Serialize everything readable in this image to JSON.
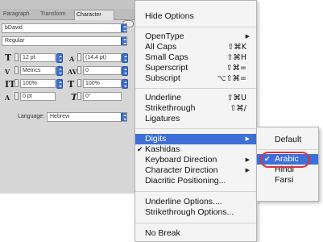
{
  "character_panel": {
    "tabs": [
      "Paragraph",
      "Transform",
      "Character"
    ],
    "font_family": "bDavid",
    "font_style": "Regular",
    "font_size": "12 pt",
    "leading": "(14.4 pt)",
    "kerning": "Metrics",
    "tracking": "0",
    "vertical_scale": "100%",
    "horizontal_scale": "100%",
    "baseline_shift": "0 pt",
    "skew": "0°",
    "language_label": "Language:",
    "language_value": "Hebrew"
  },
  "menu": {
    "hide_options": "Hide Options",
    "opentype": "OpenType",
    "all_caps": {
      "label": "All Caps",
      "shortcut": "⇧⌘K"
    },
    "small_caps": {
      "label": "Small Caps",
      "shortcut": "⇧⌘H"
    },
    "superscript": {
      "label": "Superscript",
      "shortcut": "⇧⌘="
    },
    "subscript": {
      "label": "Subscript",
      "shortcut": "⌥⇧⌘="
    },
    "underline": {
      "label": "Underline",
      "shortcut": "⇧⌘U"
    },
    "strikethrough": {
      "label": "Strikethrough",
      "shortcut": "⇧⌘/"
    },
    "ligatures": "Ligatures",
    "digits": "Digits",
    "kashidas": "Kashidas",
    "keyboard_direction": "Keyboard Direction",
    "character_direction": "Character Direction",
    "diacritic_positioning": "Diacritic Positioning...",
    "underline_options": "Underline Options....",
    "strikethrough_options": "Strikethrough Options...",
    "no_break": "No Break"
  },
  "submenu": {
    "default": "Default",
    "arabic": "Arabic",
    "hindi": "Hindi",
    "farsi": "Farsi"
  },
  "colors": {
    "highlight": "#3d6fd6",
    "ring": "#d9343b"
  }
}
